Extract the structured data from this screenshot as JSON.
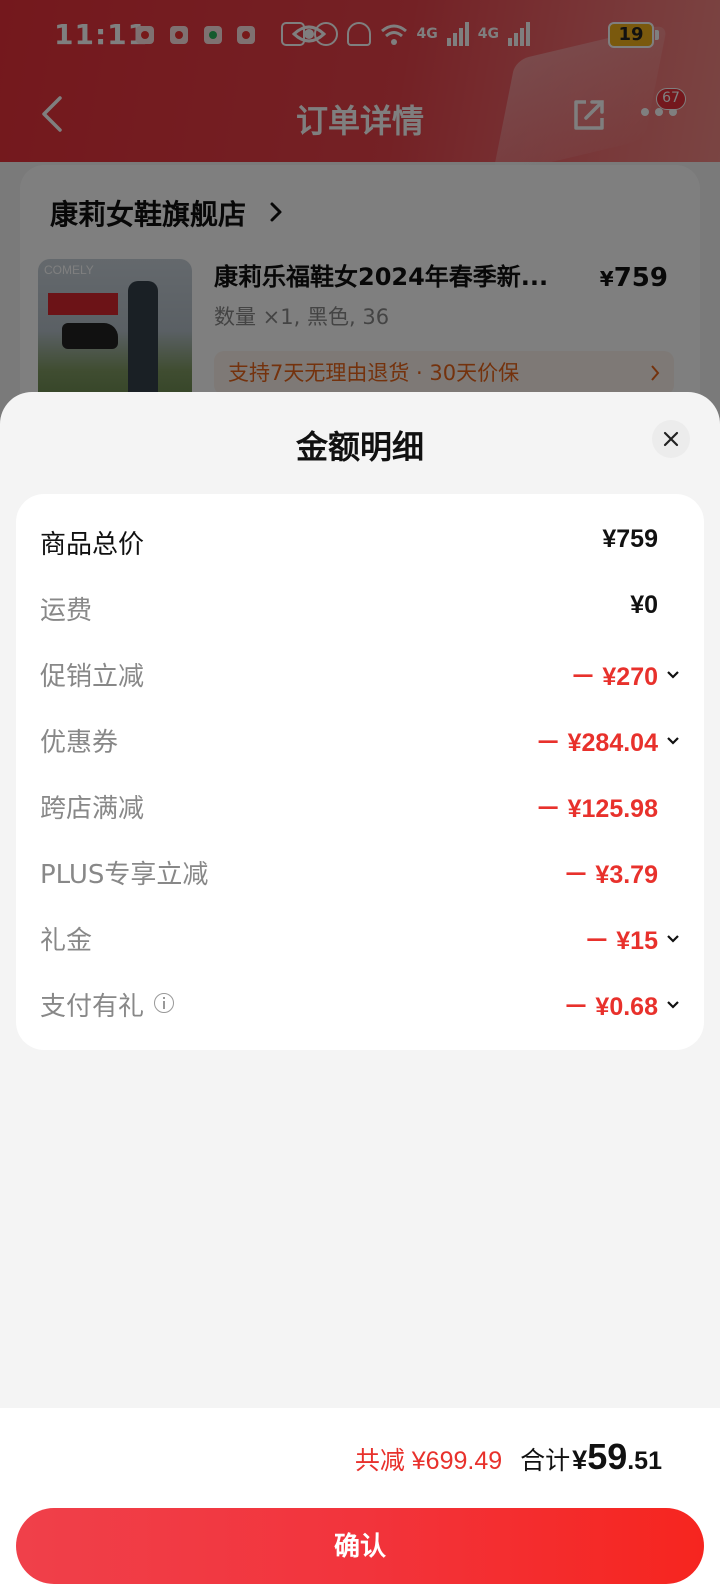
{
  "status_bar": {
    "time": "11:11",
    "battery": "19",
    "network_1": "4G",
    "network_2": "4G"
  },
  "nav": {
    "title": "订单详情",
    "message_badge": "67"
  },
  "order_card": {
    "store_name": "康莉女鞋旗舰店",
    "product_title": "康莉乐福鞋女2024年春季新...",
    "product_spec": "数量 ×1, 黑色, 36",
    "product_price_symbol": "¥",
    "product_price": "759",
    "guarantee": "支持7天无理由退货 · 30天价保",
    "image_brand": "COMELY"
  },
  "sheet": {
    "title": "金额明细",
    "rows": [
      {
        "label": "商品总价",
        "amount": "¥759",
        "has_chevron": false
      },
      {
        "label": "运费",
        "amount": "¥0",
        "has_chevron": false
      },
      {
        "label": "促销立减",
        "amount": "－ ¥270",
        "has_chevron": true
      },
      {
        "label": "优惠券",
        "amount": "－ ¥284.04",
        "has_chevron": true
      },
      {
        "label": "跨店满减",
        "amount": "－ ¥125.98",
        "has_chevron": false
      },
      {
        "label": "PLUS专享立减",
        "amount": "－ ¥3.79",
        "has_chevron": false
      },
      {
        "label": "礼金",
        "amount": "－ ¥15",
        "has_chevron": true
      },
      {
        "label": "支付有礼",
        "amount": "－ ¥0.68",
        "has_chevron": true
      }
    ]
  },
  "summary": {
    "saved": "共减 ¥699.49",
    "total_label": "合计",
    "total_symbol": "¥",
    "total_int": "59",
    "total_dec": ".51"
  },
  "confirm_label": "确认",
  "colors": {
    "brand_red": "#e8313a",
    "discount_red": "#e8312c"
  }
}
